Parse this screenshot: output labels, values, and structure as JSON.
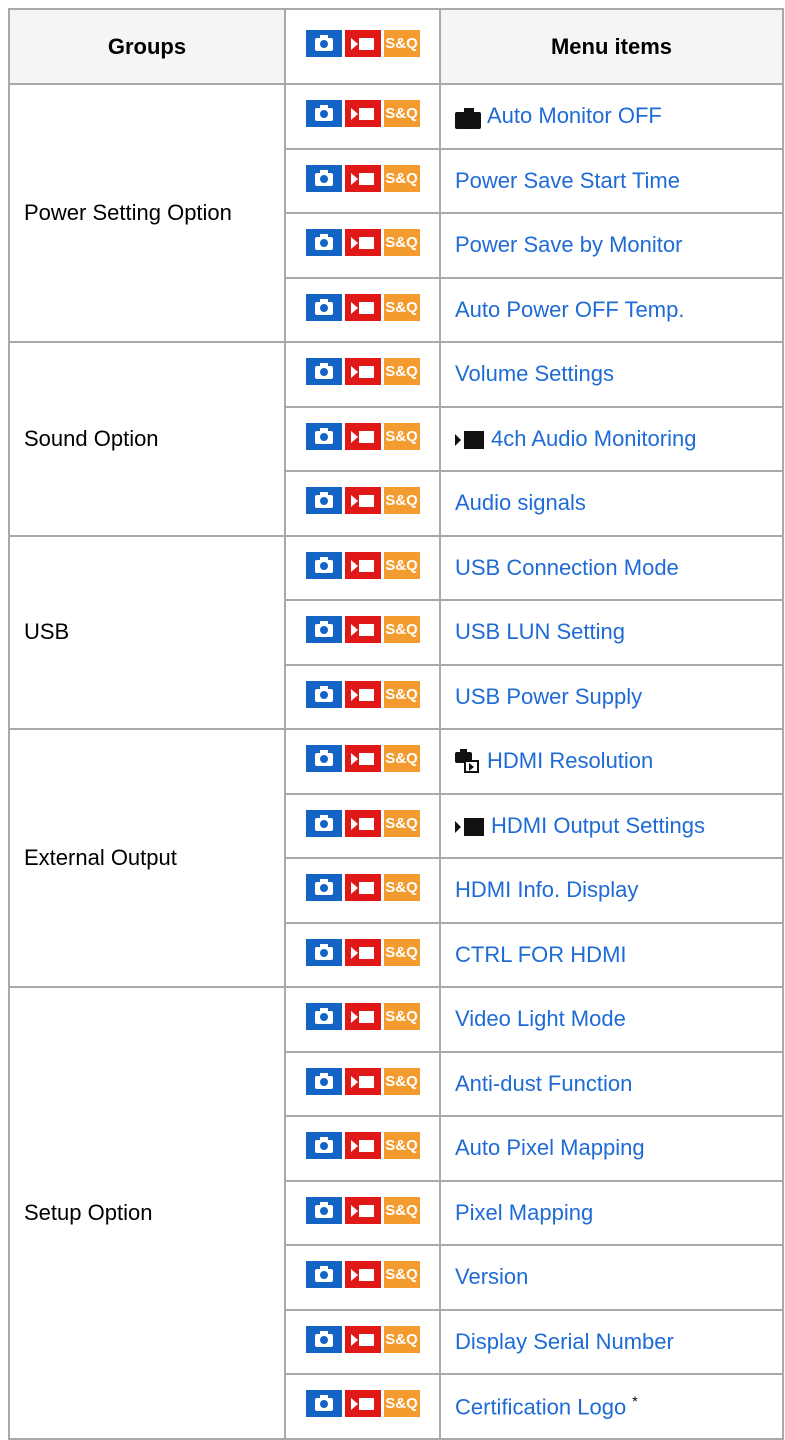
{
  "table": {
    "headers": {
      "groups": "Groups",
      "menu_items": "Menu items"
    },
    "header_icons": {
      "s_and_q": "S&Q"
    },
    "groups": [
      {
        "name": "Power Setting Option",
        "items": [
          {
            "label": "Auto Monitor OFF",
            "prefix_icon": "photo-camera-icon"
          },
          {
            "label": "Power Save Start Time"
          },
          {
            "label": "Power Save by Monitor"
          },
          {
            "label": "Auto Power OFF Temp."
          }
        ]
      },
      {
        "name": "Sound Option",
        "items": [
          {
            "label": "Volume Settings"
          },
          {
            "label": "4ch Audio Monitoring",
            "prefix_icon": "movie-icon"
          },
          {
            "label": "Audio signals"
          }
        ]
      },
      {
        "name": "USB",
        "items": [
          {
            "label": "USB Connection Mode"
          },
          {
            "label": "USB LUN Setting"
          },
          {
            "label": "USB Power Supply"
          }
        ]
      },
      {
        "name": "External Output",
        "items": [
          {
            "label": "HDMI Resolution",
            "prefix_icon": "photo-playback-icon"
          },
          {
            "label": "HDMI Output Settings",
            "prefix_icon": "movie-icon"
          },
          {
            "label": "HDMI Info. Display"
          },
          {
            "label": "CTRL FOR HDMI"
          }
        ]
      },
      {
        "name": "Setup Option",
        "items": [
          {
            "label": "Video Light Mode"
          },
          {
            "label": "Anti-dust Function"
          },
          {
            "label": "Auto Pixel Mapping"
          },
          {
            "label": "Pixel Mapping"
          },
          {
            "label": "Version"
          },
          {
            "label": "Display Serial Number"
          },
          {
            "label": "Certification Logo",
            "footnote": "*"
          }
        ]
      }
    ],
    "colors": {
      "photo_mode": "#1464c6",
      "movie_mode": "#e01818",
      "s_and_q_mode": "#f39b2e",
      "link": "#1e6bd6",
      "border": "#a9a9a9",
      "header_bg": "#f5f5f5"
    }
  }
}
